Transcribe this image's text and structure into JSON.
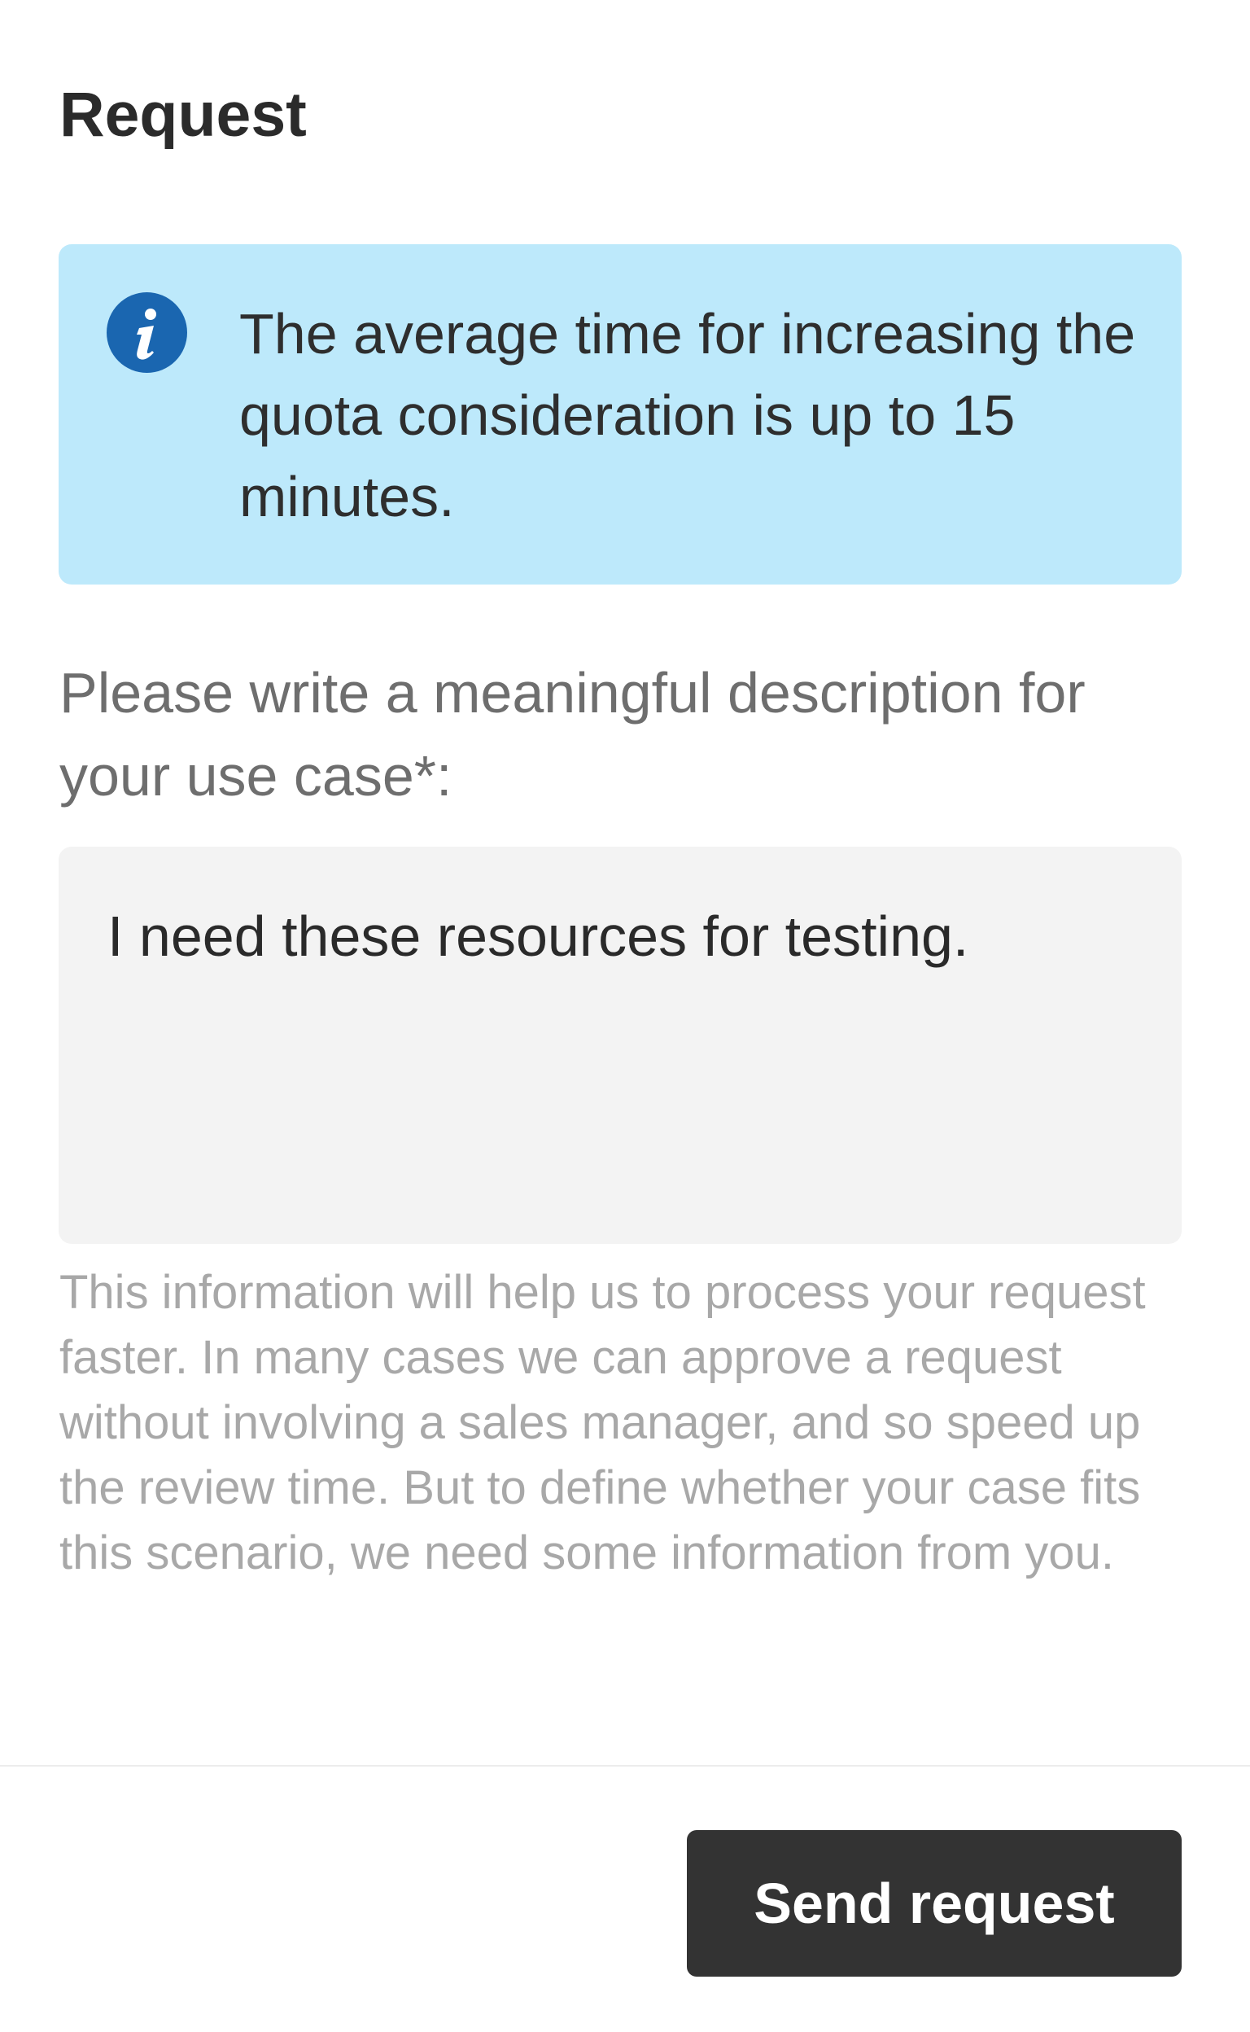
{
  "header": {
    "title": "Request"
  },
  "info": {
    "icon": "info-icon",
    "text": "The average time for increasing the quota consideration is up to 15 minutes."
  },
  "description": {
    "label": "Please write a meaningful description for your use case*:",
    "value": "I need these resources for testing.",
    "help": "This information will help us to process your request faster. In many cases we can approve a request without involving a sales manager, and so speed up the review time. But to define whether your case fits this scenario, we need some information from you."
  },
  "footer": {
    "send_label": "Send request"
  },
  "colors": {
    "info_background": "#bde9fb",
    "info_icon": "#1a66b0",
    "button_background": "#333333",
    "textarea_background": "#f3f3f3"
  }
}
